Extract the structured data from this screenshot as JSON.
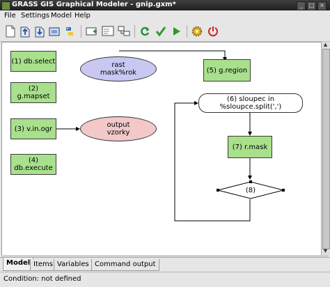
{
  "window": {
    "title": "GRASS GIS Graphical Modeler - gnip.gxm*"
  },
  "menu": {
    "file": "File",
    "settings": "Settings",
    "model": "Model",
    "help": "Help"
  },
  "toolbar": {
    "icons": [
      "new-icon",
      "open-icon",
      "save-icon",
      "export-image-icon",
      "export-python-icon",
      "add-action-icon",
      "add-data-icon",
      "add-loop-icon",
      "validate-icon",
      "check-icon",
      "run-icon",
      "settings-icon",
      "quit-icon"
    ]
  },
  "canvas": {
    "nodes": {
      "db_select": "(1) db.select",
      "g_mapset": "(2) g.mapset",
      "v_in_ogr": "(3) v.in.ogr",
      "db_execute": "(4) db.execute",
      "g_region": "(5) g.region",
      "loop": "(6) sloupec in %sloupce.split(',')",
      "r_mask": "(7) r.mask",
      "condition": "(8)",
      "rast_line1": "rast",
      "rast_line2": "mask%rok",
      "output_line1": "output",
      "output_line2": "vzorky"
    }
  },
  "tabs": [
    "Model",
    "Items",
    "Variables",
    "Command output"
  ],
  "status": "Condition: not defined",
  "colors": {
    "action": "#a8e08c",
    "raster": "#c8c8f2",
    "vector": "#f2c8c8"
  }
}
